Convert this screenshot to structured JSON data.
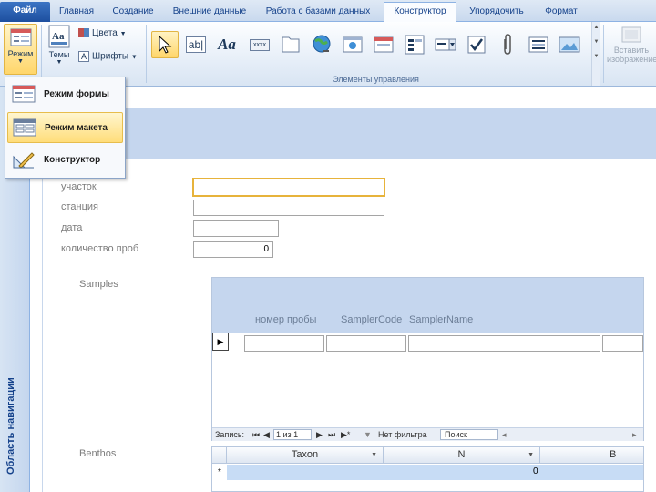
{
  "tabs": [
    "Файл",
    "Главная",
    "Создание",
    "Внешние данные",
    "Работа с базами данных",
    "Конструктор",
    "Упорядочить",
    "Формат"
  ],
  "ribbon": {
    "mode_label": "Режим",
    "themes_label": "Темы",
    "colors_label": "Цвета",
    "fonts_label": "Шрифты",
    "controls_group_label": "Элементы управления",
    "insert_image_label_1": "Вставить",
    "insert_image_label_2": "изображение",
    "aa_label": "Aa",
    "ab_label": "ab|",
    "xxxx_label": "xxxx"
  },
  "menu": {
    "items": [
      "Режим формы",
      "Режим макета",
      "Конструктор"
    ],
    "highlighted_index": 1
  },
  "nav_pane": {
    "label": "Область навигации",
    "chevron": "»"
  },
  "form": {
    "fields": [
      {
        "label": "участок",
        "value": ""
      },
      {
        "label": "станция",
        "value": ""
      },
      {
        "label": "дата",
        "value": ""
      },
      {
        "label": "количество проб",
        "value": "0"
      }
    ],
    "samples": {
      "label": "Samples",
      "columns": [
        "номер пробы",
        "SamplerCode",
        "SamplerName"
      ],
      "record_selector": "▶",
      "navigator": {
        "record_label": "Запись:",
        "first": "⏮",
        "prev": "◀",
        "position": "1 из 1",
        "next": "▶",
        "last": "⏭",
        "new": "▶*",
        "filter": "Нет фильтра",
        "search": "Поиск"
      }
    },
    "benthos": {
      "label": "Benthos",
      "columns": [
        "Taxon",
        "N",
        "B"
      ],
      "row_marker": "*",
      "n_value": "0"
    }
  },
  "colors": {
    "accent": "#e7b33b",
    "header_band": "#c5d6ee",
    "file_tab": "#2a5fb0"
  }
}
